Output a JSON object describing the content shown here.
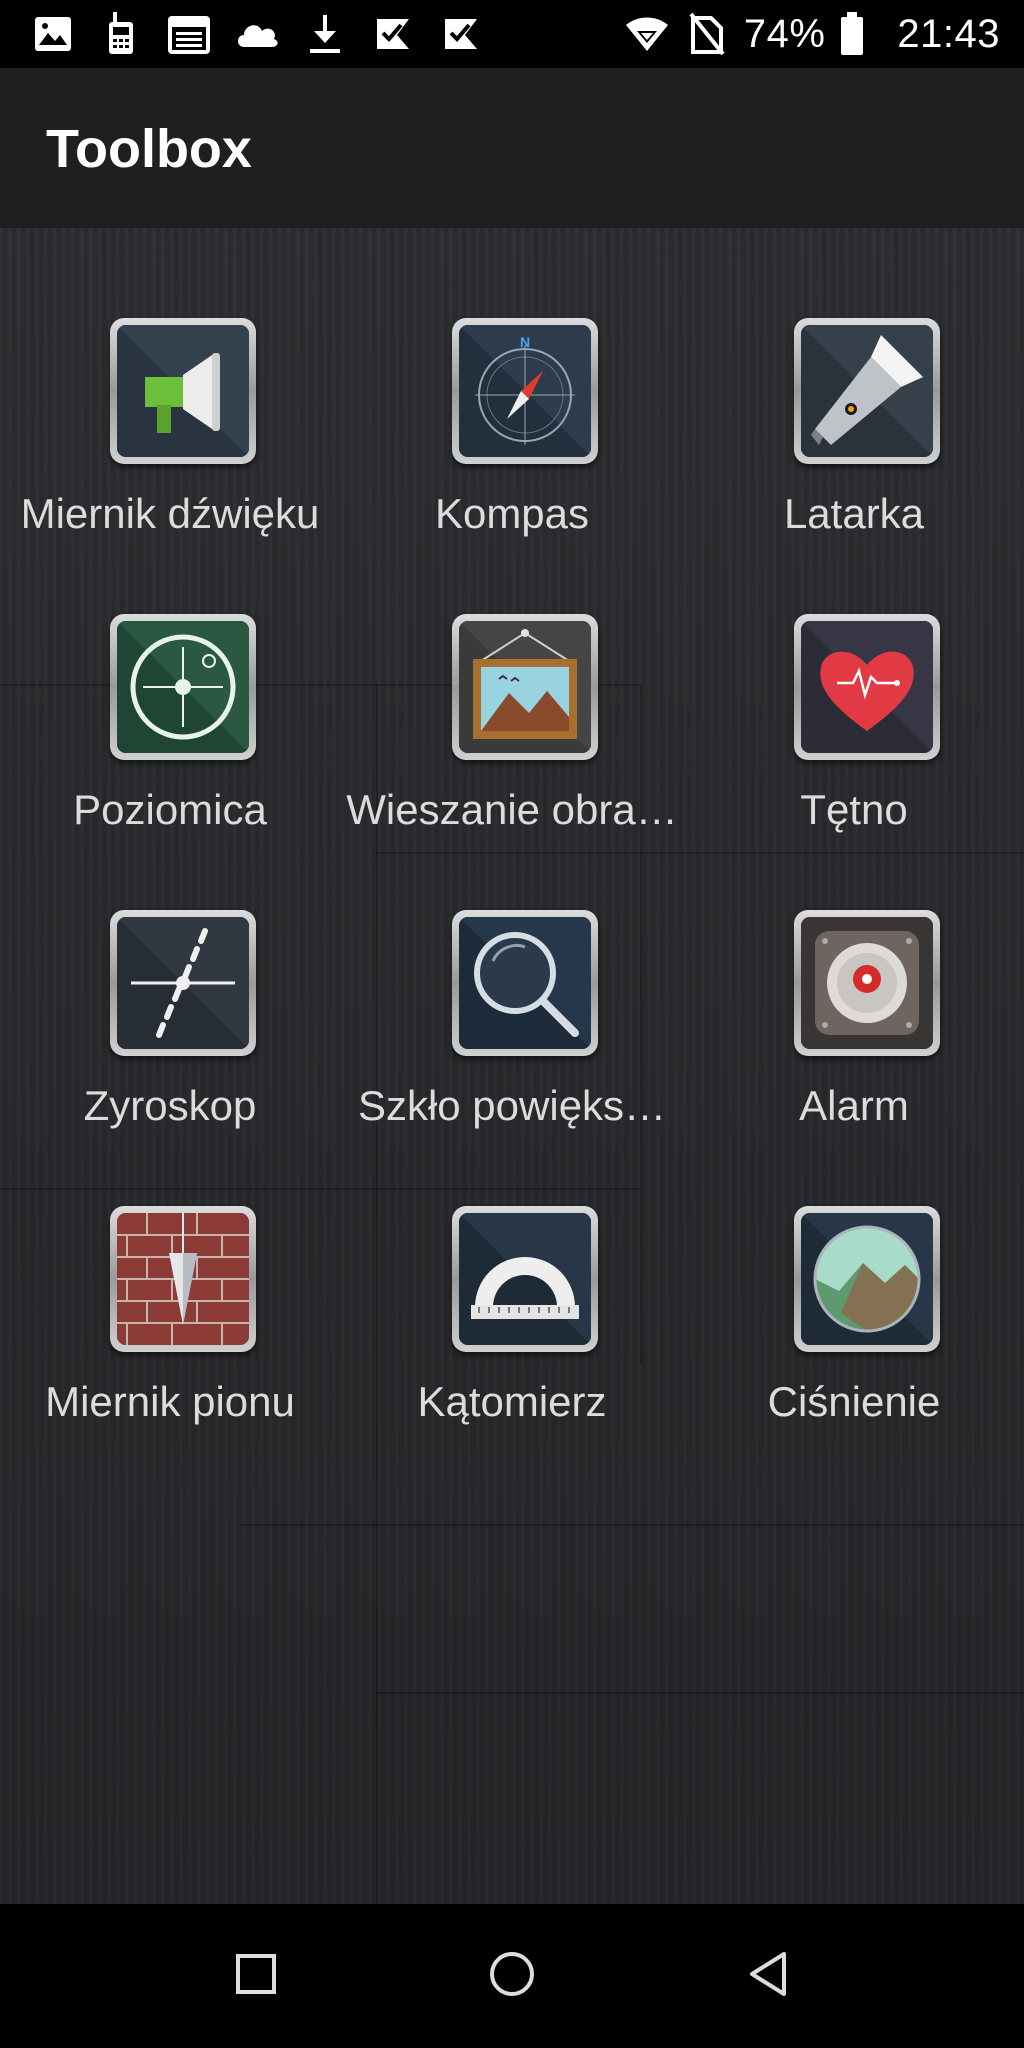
{
  "status_bar": {
    "left_icons": [
      "image-icon",
      "walkie-talkie-icon",
      "calendar-icon",
      "cloud-icon",
      "download-icon",
      "check-flag-icon",
      "check-flag-icon"
    ],
    "right_icons": [
      "wifi-icon",
      "no-sim-icon",
      "battery-icon"
    ],
    "battery": "74%",
    "time": "21:43"
  },
  "app_bar": {
    "title": "Toolbox"
  },
  "tools": [
    {
      "label": "Miernik dźwięku",
      "icon": "megaphone-icon"
    },
    {
      "label": "Kompas",
      "icon": "compass-icon"
    },
    {
      "label": "Latarka",
      "icon": "flashlight-icon"
    },
    {
      "label": "Poziomica",
      "icon": "level-icon"
    },
    {
      "label": "Wieszanie obra…",
      "icon": "picture-frame-icon"
    },
    {
      "label": "Tętno",
      "icon": "heart-rate-icon"
    },
    {
      "label": "Zyroskop",
      "icon": "gyroscope-icon"
    },
    {
      "label": "Szkło powięks…",
      "icon": "magnifier-icon"
    },
    {
      "label": "Alarm",
      "icon": "alarm-icon"
    },
    {
      "label": "Miernik pionu",
      "icon": "plumb-bob-icon"
    },
    {
      "label": "Kątomierz",
      "icon": "protractor-icon"
    },
    {
      "label": "Ciśnienie",
      "icon": "barometer-icon"
    }
  ],
  "nav_bar": {
    "buttons": [
      "recents-button",
      "home-button",
      "back-button"
    ]
  },
  "colors": {
    "status_bar": "#000000",
    "app_bar": "#1f1f1f",
    "background": "#262729",
    "label": "#dcdcdc",
    "megaphone_green": "#6bbf3a",
    "heart_red": "#e23a44",
    "alarm_red": "#d42a2a"
  }
}
